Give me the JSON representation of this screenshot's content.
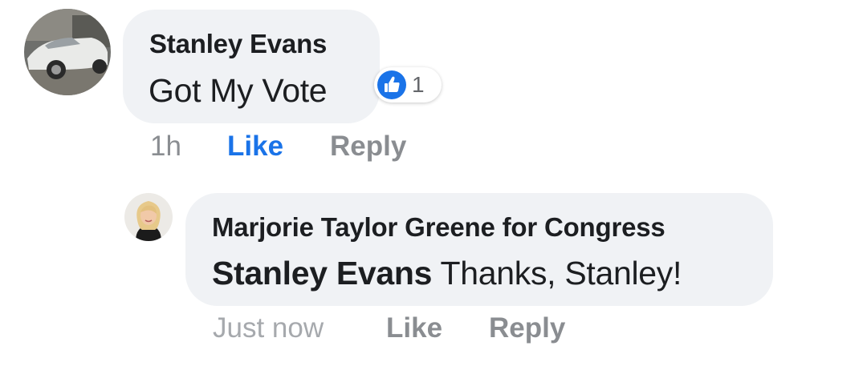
{
  "comments": [
    {
      "author": "Stanley Evans",
      "text": "Got My Vote",
      "reaction_count": "1",
      "timestamp": "1h",
      "like_label": "Like",
      "reply_label": "Reply"
    },
    {
      "author": "Marjorie Taylor Greene for Congress",
      "mention": "Stanley Evans",
      "text": "Thanks, Stanley!",
      "timestamp": "Just now",
      "like_label": "Like",
      "reply_label": "Reply"
    }
  ],
  "icons": {
    "reaction": "like-thumbs-up-icon"
  },
  "colors": {
    "bubble": "#f0f2f5",
    "like_active": "#1a73e8",
    "secondary_text": "#8a8d91"
  }
}
